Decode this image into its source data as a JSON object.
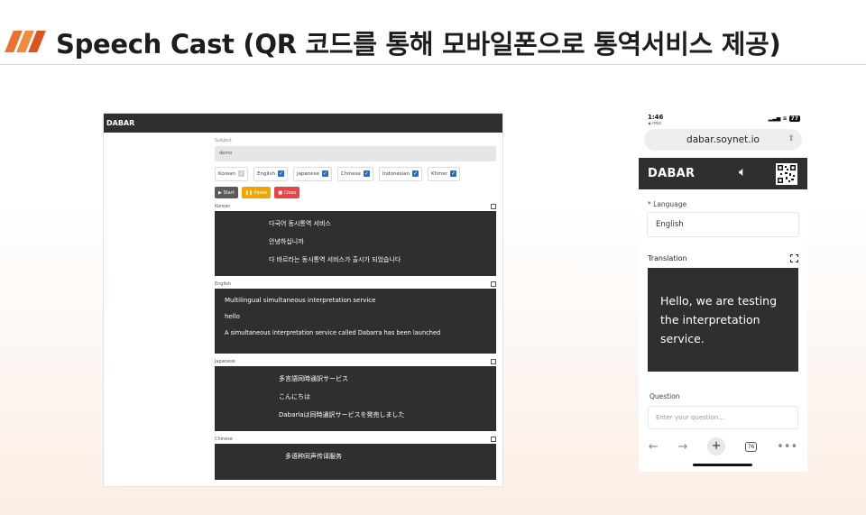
{
  "slide": {
    "title": "Speech Cast (QR 코드를 통해 모바일폰으로 통역서비스 제공)",
    "logo_colors": [
      "#e8732f",
      "#f08a3c",
      "#d9541e"
    ]
  },
  "desktop": {
    "app_title": "DABAR",
    "subject_label": "Subject",
    "subject_value": "demo",
    "languages": [
      {
        "label": "Korean",
        "checked": false
      },
      {
        "label": "English",
        "checked": true
      },
      {
        "label": "Japanese",
        "checked": true
      },
      {
        "label": "Chinese",
        "checked": true
      },
      {
        "label": "Indonesian",
        "checked": true
      },
      {
        "label": "Khmer",
        "checked": true
      }
    ],
    "buttons": [
      {
        "label": "Start",
        "icon": "play-icon",
        "color": "#5a5a5a"
      },
      {
        "label": "Pause",
        "icon": "pause-icon",
        "color": "#f0a500"
      },
      {
        "label": "Close",
        "icon": "stop-icon",
        "color": "#e84545"
      }
    ],
    "sections": [
      {
        "name": "Korean",
        "lines": [
          "다국어 동시통역 서비스",
          "안녕하십니까",
          "다 바르라는 동시통역 서비스가 출시가 되었습니다"
        ]
      },
      {
        "name": "English",
        "lines": [
          "Multilingual simultaneous interpretation service",
          "hello",
          "A simultaneous interpretation service called Dabarra has been launched"
        ]
      },
      {
        "name": "Japanese",
        "lines": [
          "多言語同時通訳サービス",
          "こんにちは",
          "Dabarlaは同時通訳サービスを発売しました"
        ]
      },
      {
        "name": "Chinese",
        "lines": [
          "多语种同声传译服务"
        ]
      }
    ]
  },
  "phone": {
    "time": "1:46",
    "back_label": "◀ 카메라",
    "battery": "77",
    "url": "dabar.soynet.io",
    "app_title": "DABAR",
    "language_label": "* Language",
    "language_value": "English",
    "translation_label": "Translation",
    "translation_text": "Hello, we are testing the interpretation service.",
    "question_label": "Question",
    "question_placeholder": "Enter your question...",
    "tabs_count": "76"
  }
}
